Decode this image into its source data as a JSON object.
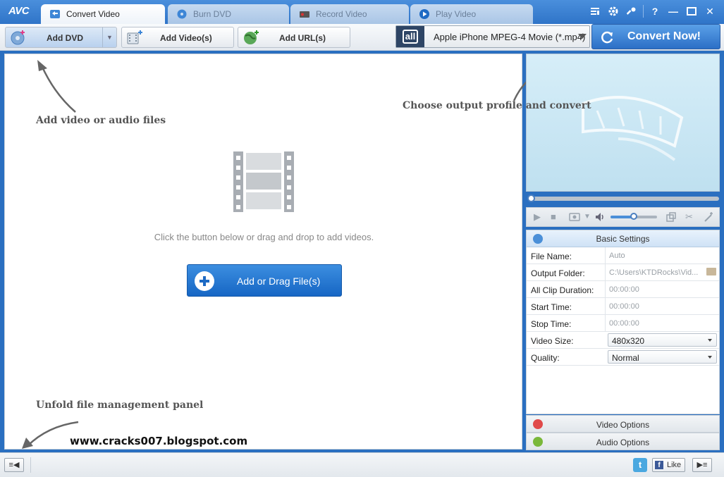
{
  "app": {
    "logo": "AVC"
  },
  "tabs": [
    {
      "label": "Convert Video",
      "icon": "convert-icon",
      "active": true
    },
    {
      "label": "Burn DVD",
      "icon": "disc-icon",
      "active": false
    },
    {
      "label": "Record Video",
      "icon": "record-icon",
      "active": false
    },
    {
      "label": "Play Video",
      "icon": "play-icon",
      "active": false
    }
  ],
  "window_controls": [
    "menu-icon",
    "gear-icon",
    "key-icon",
    "help-icon",
    "minimize-icon",
    "maximize-icon",
    "close-icon"
  ],
  "window_glyphs": {
    "help": "?",
    "minimize": "—",
    "close": "✕"
  },
  "toolbar": {
    "add_dvd": "Add DVD",
    "add_video": "Add Video(s)",
    "add_url": "Add URL(s)",
    "profile": "Apple iPhone MPEG-4 Movie (*.mp4)",
    "profile_icon_text": "all",
    "convert": "Convert Now!"
  },
  "main": {
    "hint_add": "Add video or audio files",
    "hint_profile": "Choose output profile and convert",
    "hint_unfold": "Unfold file management panel",
    "drop_text": "Click the button below or drag and drop to add videos.",
    "add_file_button": "Add or Drag File(s)",
    "watermark": "www.cracks007.blogspot.com"
  },
  "player": {
    "volume_fraction": 0.5
  },
  "settings": {
    "title": "Basic Settings",
    "rows": [
      {
        "label": "File Name:",
        "value": "Auto"
      },
      {
        "label": "Output Folder:",
        "value": "C:\\Users\\KTDRocks\\Vid..."
      },
      {
        "label": "All Clip Duration:",
        "value": "00:00:00"
      },
      {
        "label": "Start Time:",
        "value": "00:00:00"
      },
      {
        "label": "Stop Time:",
        "value": "00:00:00"
      },
      {
        "label": "Video Size:",
        "value": "480x320"
      },
      {
        "label": "Quality:",
        "value": "Normal"
      }
    ]
  },
  "options": {
    "video": "Video Options",
    "audio": "Audio Options"
  },
  "statusbar": {
    "like": "Like",
    "twitter_glyph": "t",
    "facebook_glyph": "f"
  }
}
